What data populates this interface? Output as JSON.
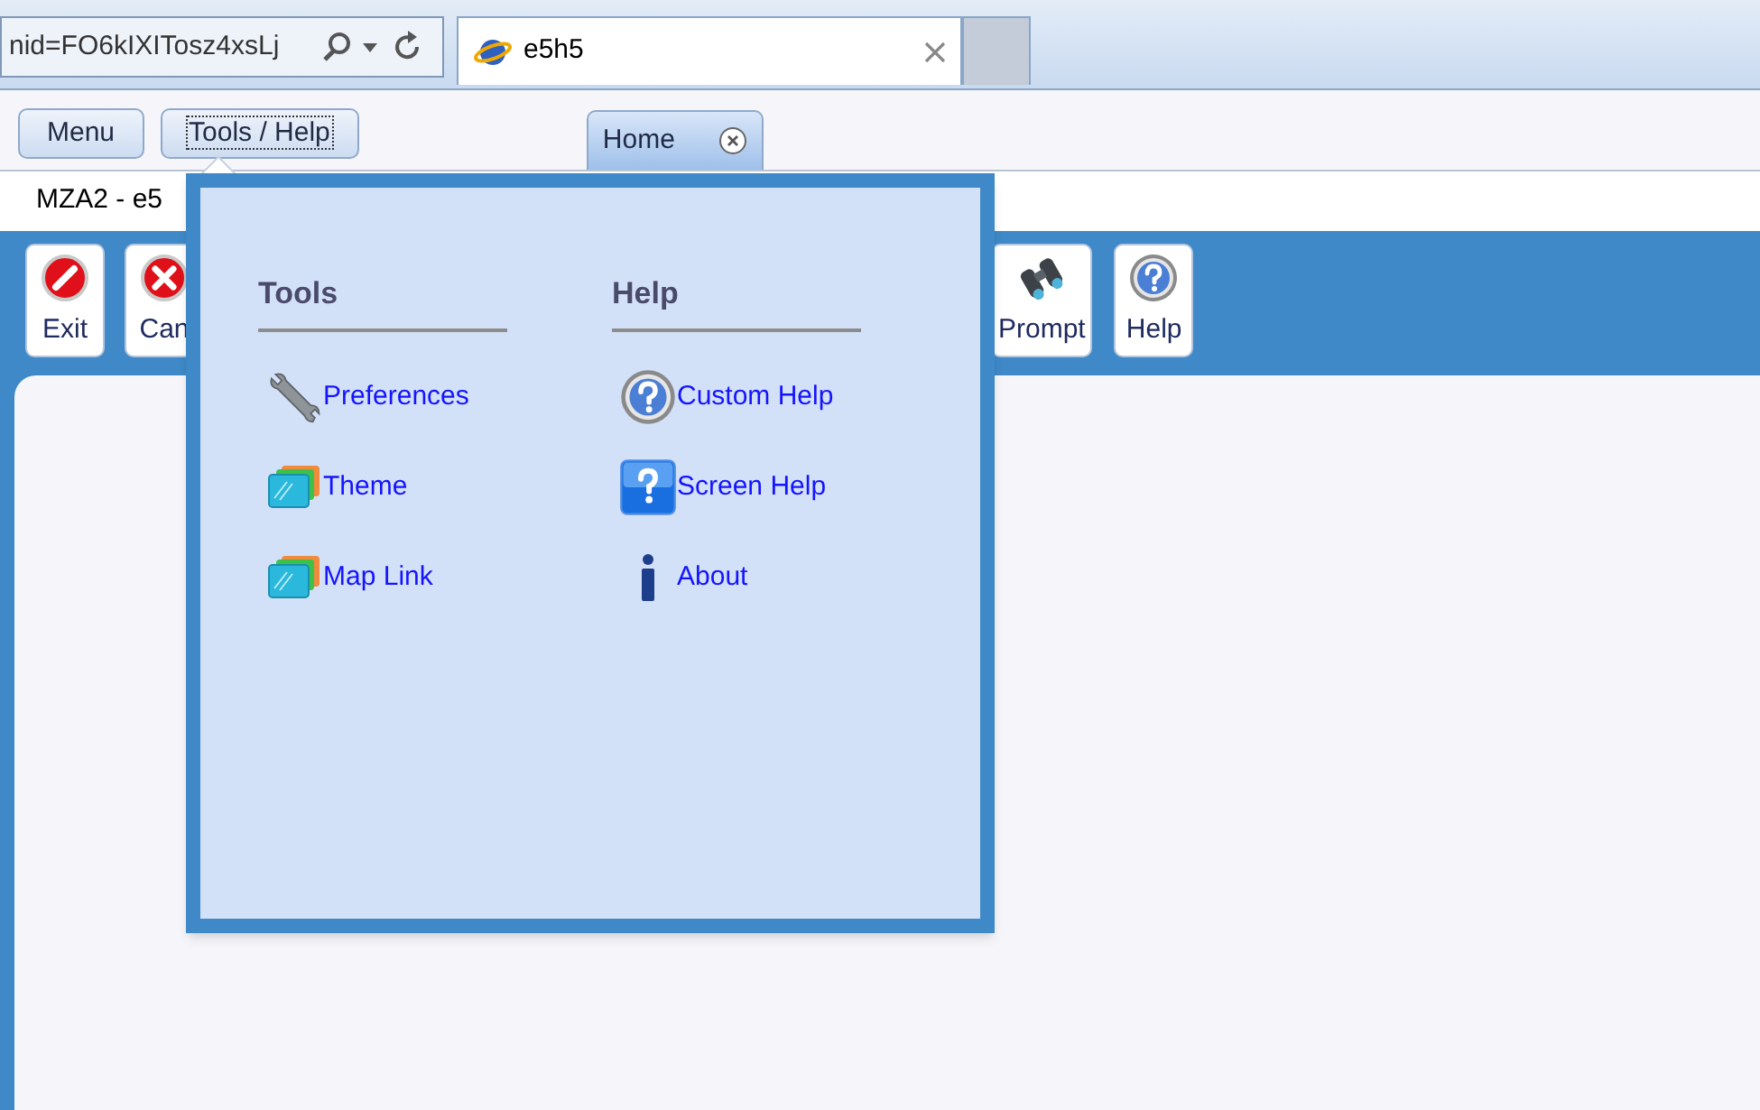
{
  "browser": {
    "address": "nid=FO6kIXITosz4xsLj",
    "tabs": [
      {
        "title": "e5h5",
        "selected": true
      }
    ]
  },
  "app": {
    "buttons": [
      {
        "label": "Menu",
        "focused": false
      },
      {
        "label": "Tools / Help",
        "focused": true
      }
    ],
    "tabs": [
      {
        "label": "Home",
        "selected": true
      }
    ],
    "title": "MZA2 - e5",
    "toolbar_left": [
      {
        "label": "Exit",
        "kind": "exit"
      },
      {
        "label": "Can",
        "kind": "cancel"
      }
    ],
    "toolbar_right": [
      {
        "label": "Prompt",
        "kind": "binoculars"
      },
      {
        "label": "Help",
        "kind": "help"
      }
    ]
  },
  "popup": {
    "sections": [
      {
        "heading": "Tools",
        "items": [
          {
            "label": "Preferences",
            "kind": "wrench"
          },
          {
            "label": "Theme",
            "kind": "screens"
          },
          {
            "label": "Map Link",
            "kind": "screens"
          }
        ]
      },
      {
        "heading": "Help",
        "items": [
          {
            "label": "Custom Help",
            "kind": "help"
          },
          {
            "label": "Screen Help",
            "kind": "helpsquare"
          },
          {
            "label": "About",
            "kind": "info"
          }
        ]
      }
    ]
  }
}
